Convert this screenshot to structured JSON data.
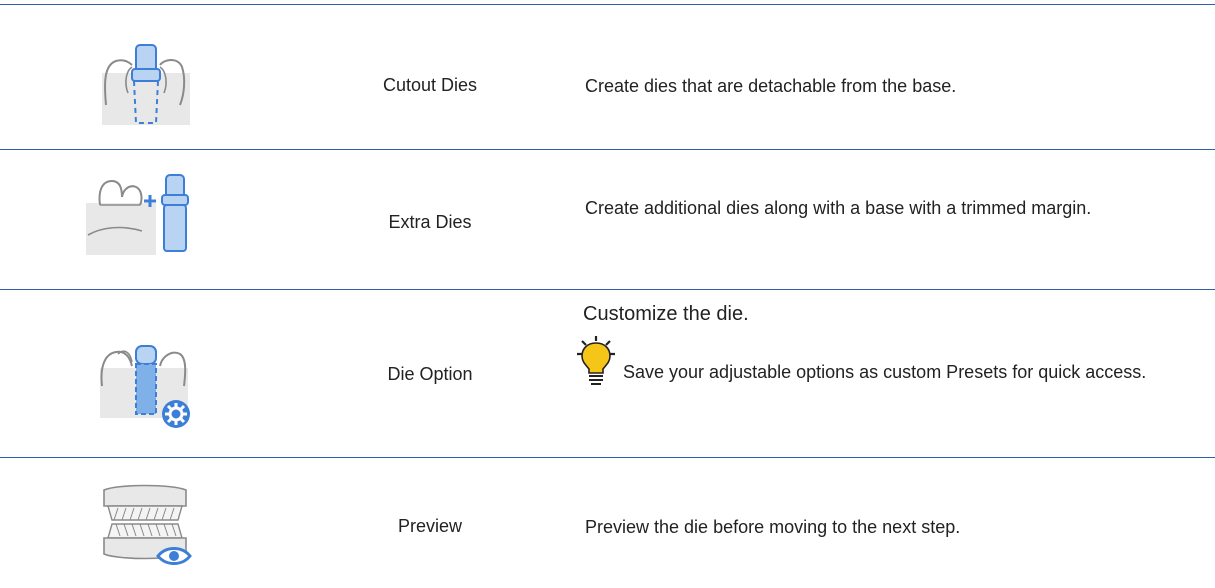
{
  "rows": [
    {
      "icon": "cutout-dies-icon",
      "name": "Cutout Dies",
      "description": "Create dies that are detachable from the base."
    },
    {
      "icon": "extra-dies-icon",
      "name": "Extra Dies",
      "description": "Create additional dies along with a base with a trimmed margin."
    },
    {
      "icon": "die-option-icon",
      "name": "Die Option",
      "description": "Customize the die.",
      "tip_icon": "lightbulb-icon",
      "tip": "Save your adjustable options as custom Presets for quick access."
    },
    {
      "icon": "preview-icon",
      "name": "Preview",
      "description": "Preview the die before moving to the next step."
    }
  ],
  "colors": {
    "rule": "#2f5fa8",
    "icon_blue": "#3d7fd6",
    "icon_fill_blue": "#b9d3f3",
    "gray_fill": "#e8e8e8",
    "gray_stroke": "#8a8a8a",
    "bulb_yellow": "#f5c518"
  }
}
